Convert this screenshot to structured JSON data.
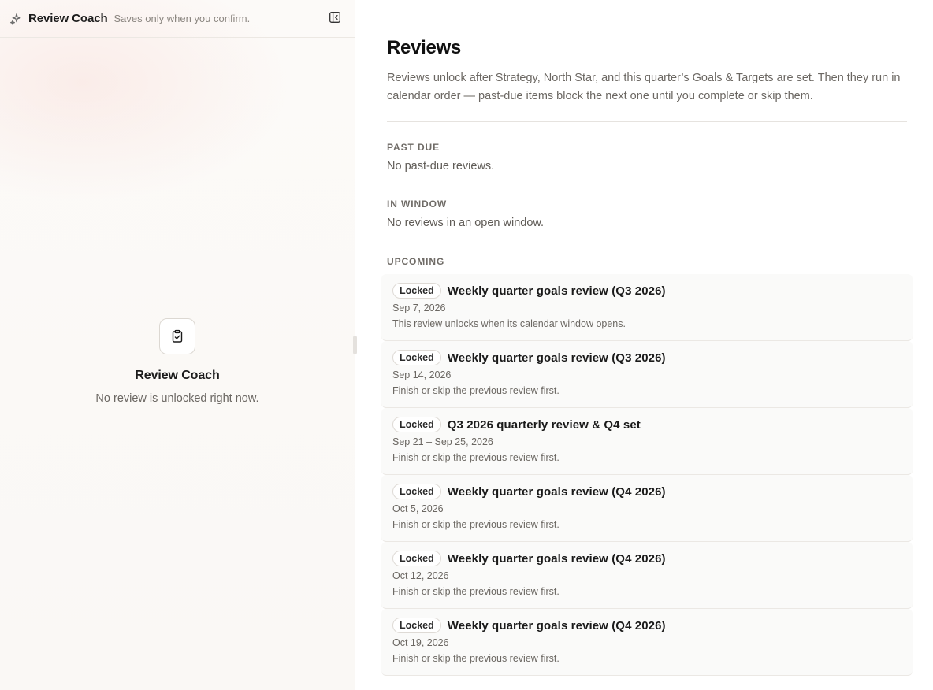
{
  "coach": {
    "title": "Review Coach",
    "subtitle": "Saves only when you confirm.",
    "header_icon": "sparkle-icon",
    "collapse_icon": "sidebar-collapse-icon",
    "empty_icon": "clipboard-check-icon",
    "empty_title": "Review Coach",
    "empty_text": "No review is unlocked right now."
  },
  "main": {
    "title": "Reviews",
    "description": "Reviews unlock after Strategy, North Star, and this quarter’s Goals & Targets are set. Then they run in calendar order — past-due items block the next one until you complete or skip them.",
    "sections": {
      "past_due": {
        "label": "PAST DUE",
        "empty": "No past-due reviews."
      },
      "in_window": {
        "label": "IN WINDOW",
        "empty": "No reviews in an open window."
      },
      "upcoming": {
        "label": "UPCOMING"
      }
    },
    "upcoming": [
      {
        "badge": "Locked",
        "title": "Weekly quarter goals review (Q3 2026)",
        "date": "Sep 7, 2026",
        "note": "This review unlocks when its calendar window opens."
      },
      {
        "badge": "Locked",
        "title": "Weekly quarter goals review (Q3 2026)",
        "date": "Sep 14, 2026",
        "note": "Finish or skip the previous review first."
      },
      {
        "badge": "Locked",
        "title": "Q3 2026 quarterly review & Q4 set",
        "date": "Sep 21 – Sep 25, 2026",
        "note": "Finish or skip the previous review first."
      },
      {
        "badge": "Locked",
        "title": "Weekly quarter goals review (Q4 2026)",
        "date": "Oct 5, 2026",
        "note": "Finish or skip the previous review first."
      },
      {
        "badge": "Locked",
        "title": "Weekly quarter goals review (Q4 2026)",
        "date": "Oct 12, 2026",
        "note": "Finish or skip the previous review first."
      },
      {
        "badge": "Locked",
        "title": "Weekly quarter goals review (Q4 2026)",
        "date": "Oct 19, 2026",
        "note": "Finish or skip the previous review first."
      }
    ]
  },
  "colors": {
    "accent_tint": "#f9e1dc",
    "panel_bg": "#faf8f5",
    "muted_text": "#6b6762"
  }
}
